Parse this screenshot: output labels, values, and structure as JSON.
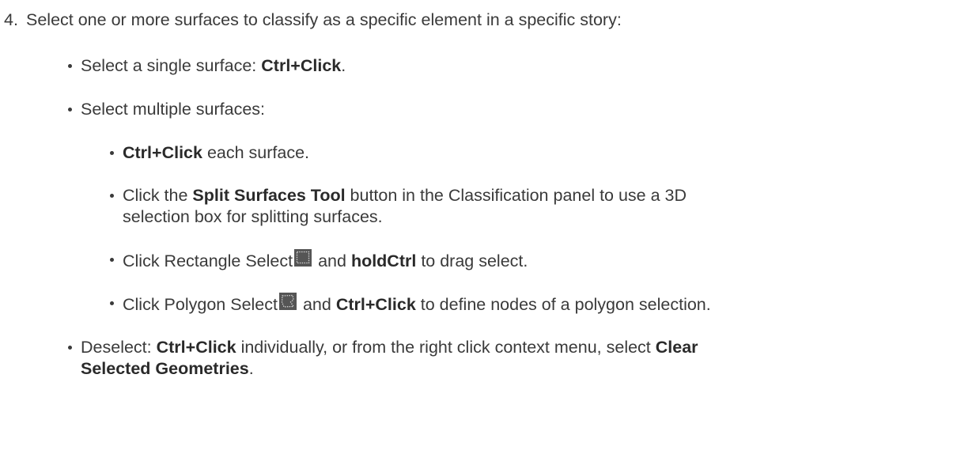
{
  "step": {
    "number": "4.",
    "text": "Select one or more surfaces to classify as a specific element in a specific story:"
  },
  "items": [
    {
      "pre": "Select a single surface: ",
      "bold": "Ctrl+Click",
      "post": "."
    },
    {
      "pre": "Select multiple surfaces:"
    },
    {
      "bold": "Ctrl+Click",
      "post": " each surface."
    },
    {
      "pre": "Click the ",
      "bold": "Split Surfaces Tool",
      "post": " button in the Classification panel to use a 3D",
      "line2": "selection box for splitting surfaces."
    },
    {
      "pre": "Click Rectangle Select",
      "mid": " and ",
      "bold": "holdCtrl",
      "post": " to drag select."
    },
    {
      "pre": "Click Polygon Select",
      "mid": " and ",
      "bold": "Ctrl+Click",
      "post": " to define nodes of a polygon selection."
    },
    {
      "pre": "Deselect: ",
      "bold": "Ctrl+Click",
      "post": " individually, or from the right click context menu, select ",
      "bold2": "Clear",
      "line2_bold": "Selected Geometries",
      "line2_post": "."
    }
  ],
  "icons": {
    "rectangle_select": "rectangle-select-icon",
    "polygon_select": "polygon-select-icon"
  }
}
